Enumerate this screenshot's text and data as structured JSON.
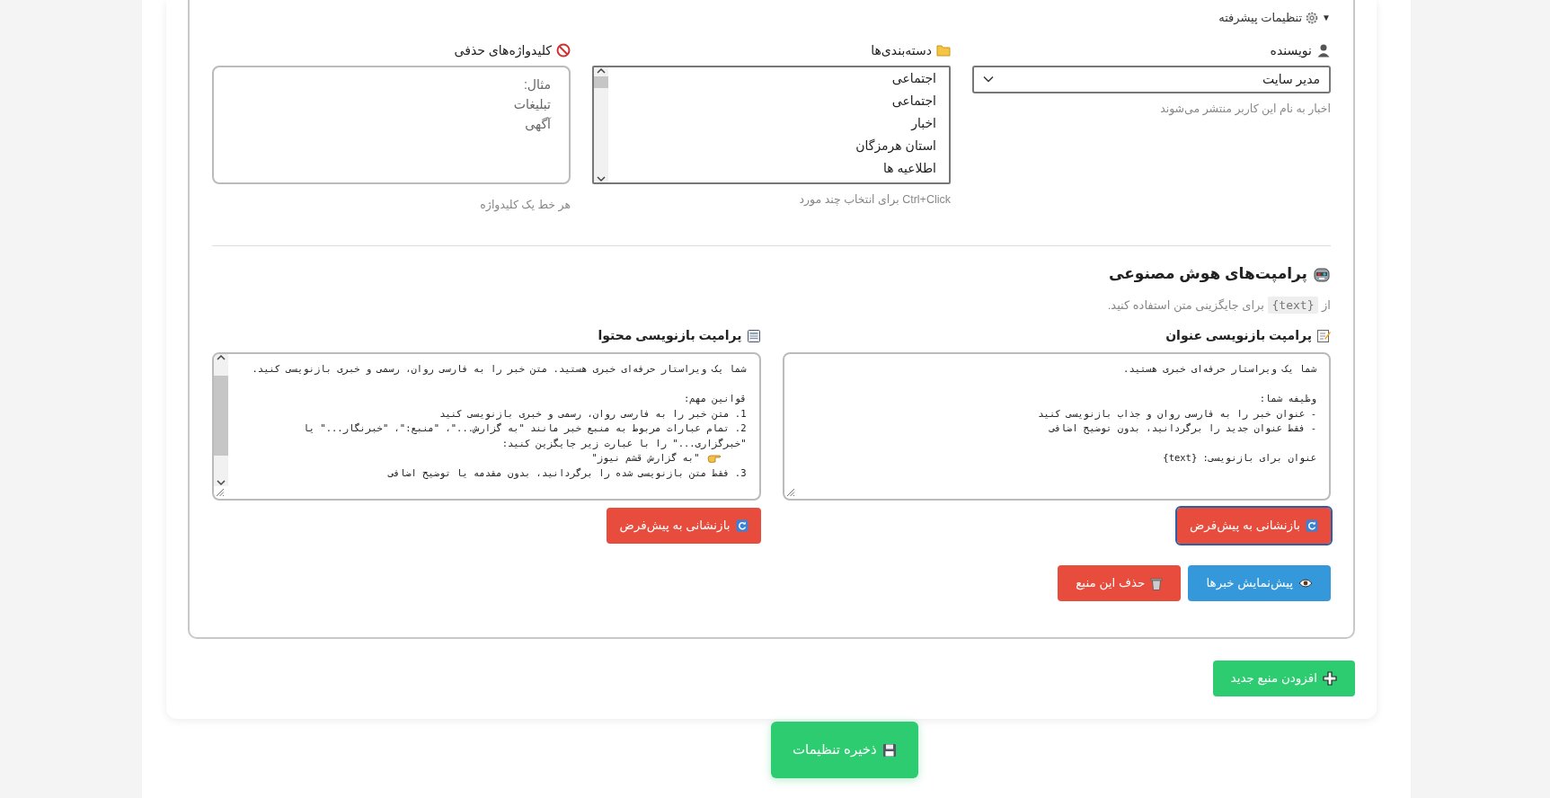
{
  "advanced": {
    "toggle": "▼",
    "label": "تنظیمات پیشرفته",
    "expanded": true
  },
  "fields": [
    {
      "kind": "select",
      "label": "نویسنده",
      "value": "مدیر سایت",
      "help": "اخبار به نام این کاربر منتشر می‌شوند"
    },
    {
      "kind": "listbox",
      "label": "دسته‌بندی‌ها",
      "options": [
        {
          "text": "اجتماعی",
          "selected": false
        },
        {
          "text": "اجتماعی",
          "selected": false
        },
        {
          "text": "اخبار",
          "selected": false
        },
        {
          "text": "استان هرمزگان",
          "selected": false
        },
        {
          "text": "اطلاعیه ها",
          "selected": false
        }
      ],
      "help": "Ctrl+Click برای انتخاب چند مورد"
    },
    {
      "kind": "textarea",
      "label": "کلیدواژه‌های حذفی",
      "placeholder": "مثال:\nتبلیغات\nآگهی",
      "help": "هر خط یک کلیدواژه"
    }
  ],
  "ai": {
    "title": "پرامپت‌های هوش مصنوعی",
    "hint": {
      "before": "از",
      "code": "{text}",
      "after": "برای جایگزینی متن استفاده کنید."
    },
    "prompts": [
      {
        "kind": "title",
        "label": "پرامپت بازنویسی عنوان",
        "lines": [
          {
            "kind": "text",
            "text": "شما یک ویراستار حرفه‌ای خبری هستید."
          },
          {
            "kind": "gap"
          },
          {
            "kind": "text",
            "text": "وظیفه شما:"
          },
          {
            "kind": "text",
            "text": "- عنوان خبر را به فارسی روان و جذاب بازنویسی کنید"
          },
          {
            "kind": "text",
            "text": "- فقط عنوان جدید را برگردانید، بدون توضیح اضافی"
          },
          {
            "kind": "gap"
          },
          {
            "kind": "text",
            "text": "عنوان برای بازنویسی: {text}"
          }
        ],
        "reset": {
          "label": "بازنشانی به پیش‌فرض",
          "focused": true
        }
      },
      {
        "kind": "content",
        "label": "پرامپت بازنویسی محتوا",
        "lines": [
          {
            "kind": "text",
            "text": "شما یک ویراستار حرفه‌ای خبری هستید. متن خبر را به فارسی روان، رسمی و خبری بازنویسی کنید."
          },
          {
            "kind": "gap"
          },
          {
            "kind": "text",
            "text": "قوانین مهم:"
          },
          {
            "kind": "text",
            "text": "1. متن خبر را به فارسی روان، رسمی و خبری بازنویسی کنید"
          },
          {
            "kind": "text",
            "text": "2. تمام عبارات مربوط به منبع خبر مانند \"به گزارش...\"، \"منبع:\"، \"خبرنگار...\" یا \"خبرگزاری...\" را با عبارت زیر جایگزین کنید:"
          },
          {
            "kind": "pointer",
            "text": "\"به گزارش قشم نیوز\""
          },
          {
            "kind": "text",
            "text": "3. فقط متن بازنویسی شده را برگردانید، بدون مقدمه یا توضیح اضافی"
          }
        ],
        "reset": {
          "label": "بازنشانی به پیش‌فرض",
          "focused": false
        }
      }
    ]
  },
  "actions": [
    {
      "kind": "preview",
      "label": "پیش‌نمایش خبرها"
    },
    {
      "kind": "delete",
      "label": "حذف این منبع"
    }
  ],
  "add_button": "افزودن منبع جدید",
  "save_button": "ذخیره تنظیمات"
}
